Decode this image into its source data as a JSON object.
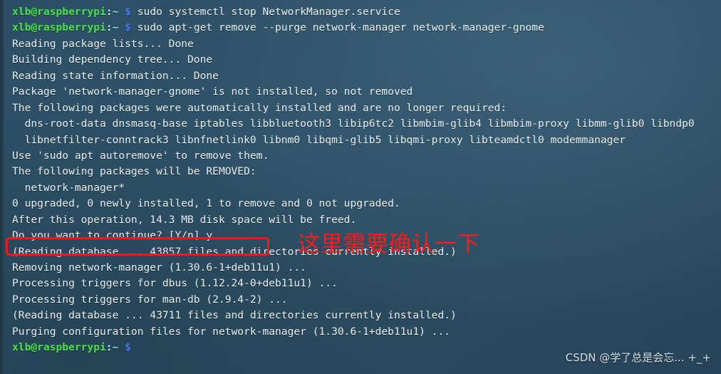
{
  "terminal": {
    "prompt": {
      "user_host": "xlb@raspberrypi",
      "separator": ":",
      "path": "~",
      "symbol": "$",
      "colors": {
        "user_host": "#4ae04a",
        "path": "#8fd6e8",
        "symbol": "#3a7bff",
        "text": "#e9eef1",
        "background": "#2e5268"
      }
    },
    "lines": [
      {
        "type": "prompt",
        "command": " sudo systemctl stop NetworkManager.service"
      },
      {
        "type": "prompt",
        "command": " sudo apt-get remove --purge network-manager network-manager-gnome"
      },
      {
        "type": "output",
        "text": "Reading package lists... Done"
      },
      {
        "type": "output",
        "text": "Building dependency tree... Done"
      },
      {
        "type": "output",
        "text": "Reading state information... Done"
      },
      {
        "type": "output",
        "text": "Package 'network-manager-gnome' is not installed, so not removed"
      },
      {
        "type": "output",
        "text": "The following packages were automatically installed and are no longer required:"
      },
      {
        "type": "output",
        "text": "  dns-root-data dnsmasq-base iptables libbluetooth3 libip6tc2 libmbim-glib4 libmbim-proxy libmm-glib0 libndp0"
      },
      {
        "type": "output",
        "text": "  libnetfilter-conntrack3 libnfnetlink0 libnm0 libqmi-glib5 libqmi-proxy libteamdctl0 modemmanager"
      },
      {
        "type": "output",
        "text": "Use 'sudo apt autoremove' to remove them."
      },
      {
        "type": "output",
        "text": "The following packages will be REMOVED:"
      },
      {
        "type": "output",
        "text": "  network-manager*"
      },
      {
        "type": "output",
        "text": "0 upgraded, 0 newly installed, 1 to remove and 0 not upgraded."
      },
      {
        "type": "output",
        "text": "After this operation, 14.3 MB disk space will be freed."
      },
      {
        "type": "output",
        "text": "Do you want to continue? [Y/n] y"
      },
      {
        "type": "output",
        "text": "(Reading database ... 43857 files and directories currently installed.)"
      },
      {
        "type": "output",
        "text": "Removing network-manager (1.30.6-1+deb11u1) ..."
      },
      {
        "type": "output",
        "text": "Processing triggers for dbus (1.12.24-0+deb11u1) ..."
      },
      {
        "type": "output",
        "text": "Processing triggers for man-db (2.9.4-2) ..."
      },
      {
        "type": "output",
        "text": "(Reading database ... 43711 files and directories currently installed.)"
      },
      {
        "type": "output",
        "text": "Purging configuration files for network-manager (1.30.6-1+deb11u1) ..."
      },
      {
        "type": "prompt",
        "command": ""
      }
    ]
  },
  "annotations": {
    "confirm_note": "这里需要确认一下",
    "confirm_note_color": "#fb1b1b",
    "highlight_box_color": "#fa1616"
  },
  "watermark": {
    "text": "CSDN @学了总是会忘... +_+"
  }
}
